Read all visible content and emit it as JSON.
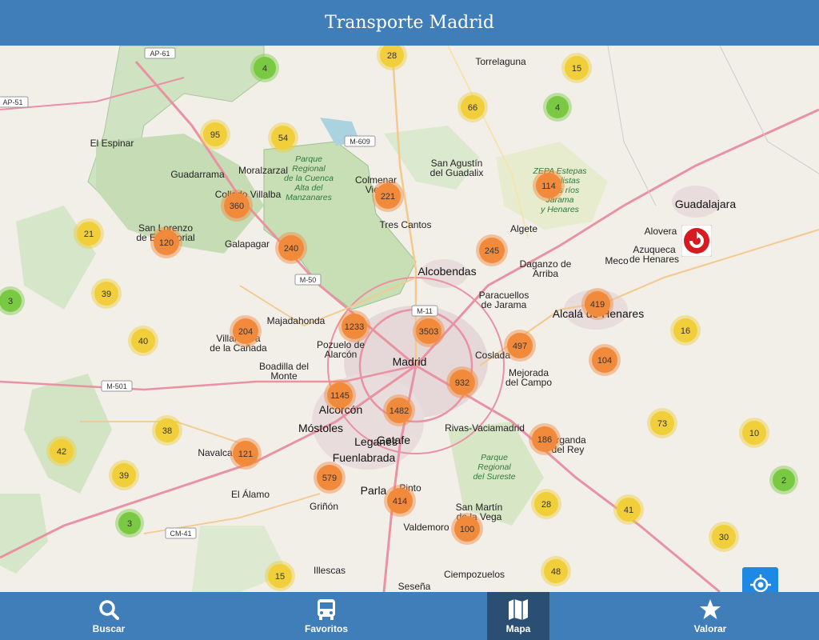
{
  "header": {
    "title": "Transporte Madrid"
  },
  "map": {
    "places": [
      {
        "name": "Madrid",
        "big": true
      },
      {
        "name": "Alcobendas",
        "big": true
      },
      {
        "name": "Alcalá de Henares",
        "big": true
      },
      {
        "name": "Getafe",
        "big": true
      },
      {
        "name": "Fuenlabrada",
        "big": true
      },
      {
        "name": "Leganés",
        "big": true
      },
      {
        "name": "Móstoles",
        "big": true
      },
      {
        "name": "Alcorcón",
        "big": true
      },
      {
        "name": "Parla",
        "big": true
      },
      {
        "name": "Guadalajara",
        "big": true
      },
      {
        "name": "Torrelaguna",
        "big": false
      },
      {
        "name": "El Espinar",
        "big": false
      },
      {
        "name": "Guadarrama",
        "big": false
      },
      {
        "name": "Moralzarzal",
        "big": false
      },
      {
        "name": "Collado Villalba",
        "big": false
      },
      {
        "name": "Galapagar",
        "big": false
      },
      {
        "name": "San Lorenzo de El Escorial",
        "big": false
      },
      {
        "name": "Colmenar Viejo",
        "big": false
      },
      {
        "name": "San Agustín del Guadalix",
        "big": false
      },
      {
        "name": "Tres Cantos",
        "big": false
      },
      {
        "name": "Algete",
        "big": false
      },
      {
        "name": "Daganzo de Arriba",
        "big": false
      },
      {
        "name": "Paracuellos de Jarama",
        "big": false
      },
      {
        "name": "Majadahonda",
        "big": false
      },
      {
        "name": "Pozuelo de Alarcón",
        "big": false
      },
      {
        "name": "Villanueva de la Cañada",
        "big": false
      },
      {
        "name": "Boadilla del Monte",
        "big": false
      },
      {
        "name": "Coslada",
        "big": false
      },
      {
        "name": "Mejorada del Campo",
        "big": false
      },
      {
        "name": "Rivas-Vaciamadrid",
        "big": false
      },
      {
        "name": "Arganda del Rey",
        "big": false
      },
      {
        "name": "Navalcarnero",
        "big": false
      },
      {
        "name": "El Álamo",
        "big": false
      },
      {
        "name": "Griñón",
        "big": false
      },
      {
        "name": "Pinto",
        "big": false
      },
      {
        "name": "Valdemoro",
        "big": false
      },
      {
        "name": "San Martín de la Vega",
        "big": false
      },
      {
        "name": "Ciempozuelos",
        "big": false
      },
      {
        "name": "Illescas",
        "big": false
      },
      {
        "name": "Seseña",
        "big": false
      },
      {
        "name": "Alovera",
        "big": false
      },
      {
        "name": "Azuqueca de Henares",
        "big": false
      },
      {
        "name": "Meco",
        "big": false
      }
    ],
    "parks": [
      "Parque Regional de la Cuenca Alta del Manzanares",
      "ZEPA Estepas cerealistas de los ríos Jarama y Henares",
      "Parque Regional del Sureste"
    ],
    "roads": [
      "AP-61",
      "AP-51",
      "M-609",
      "M-50",
      "M-11",
      "M-501",
      "CM-41"
    ],
    "clusters": [
      {
        "count": "28",
        "level": "yellow"
      },
      {
        "count": "15",
        "level": "yellow"
      },
      {
        "count": "4",
        "level": "green"
      },
      {
        "count": "66",
        "level": "yellow"
      },
      {
        "count": "4",
        "level": "green"
      },
      {
        "count": "95",
        "level": "yellow"
      },
      {
        "count": "54",
        "level": "yellow"
      },
      {
        "count": "221",
        "level": "orange"
      },
      {
        "count": "114",
        "level": "orange"
      },
      {
        "count": "360",
        "level": "orange"
      },
      {
        "count": "21",
        "level": "yellow"
      },
      {
        "count": "120",
        "level": "orange"
      },
      {
        "count": "240",
        "level": "orange"
      },
      {
        "count": "245",
        "level": "orange"
      },
      {
        "count": "3",
        "level": "green"
      },
      {
        "count": "39",
        "level": "yellow"
      },
      {
        "count": "419",
        "level": "orange"
      },
      {
        "count": "16",
        "level": "yellow"
      },
      {
        "count": "204",
        "level": "orange"
      },
      {
        "count": "1233",
        "level": "orange"
      },
      {
        "count": "3503",
        "level": "orange"
      },
      {
        "count": "497",
        "level": "orange"
      },
      {
        "count": "40",
        "level": "yellow"
      },
      {
        "count": "104",
        "level": "orange"
      },
      {
        "count": "932",
        "level": "orange"
      },
      {
        "count": "1145",
        "level": "orange"
      },
      {
        "count": "1482",
        "level": "orange"
      },
      {
        "count": "73",
        "level": "yellow"
      },
      {
        "count": "38",
        "level": "yellow"
      },
      {
        "count": "10",
        "level": "yellow"
      },
      {
        "count": "186",
        "level": "orange"
      },
      {
        "count": "42",
        "level": "yellow"
      },
      {
        "count": "121",
        "level": "orange"
      },
      {
        "count": "2",
        "level": "green"
      },
      {
        "count": "39",
        "level": "yellow"
      },
      {
        "count": "579",
        "level": "orange"
      },
      {
        "count": "28",
        "level": "yellow"
      },
      {
        "count": "41",
        "level": "yellow"
      },
      {
        "count": "414",
        "level": "orange"
      },
      {
        "count": "3",
        "level": "green"
      },
      {
        "count": "100",
        "level": "orange"
      },
      {
        "count": "30",
        "level": "yellow"
      },
      {
        "count": "15",
        "level": "yellow"
      },
      {
        "count": "48",
        "level": "yellow"
      }
    ],
    "colors": {
      "orange": "#f28a3c",
      "yellow": "#f0cf3a",
      "green": "#7ac943"
    }
  },
  "tabs": [
    {
      "label": "Buscar",
      "icon": "search-icon"
    },
    {
      "label": "Favoritos",
      "icon": "bus-icon"
    },
    {
      "label": "Mapa",
      "icon": "map-icon",
      "active": true
    },
    {
      "label": "Valorar",
      "icon": "star-icon"
    }
  ]
}
